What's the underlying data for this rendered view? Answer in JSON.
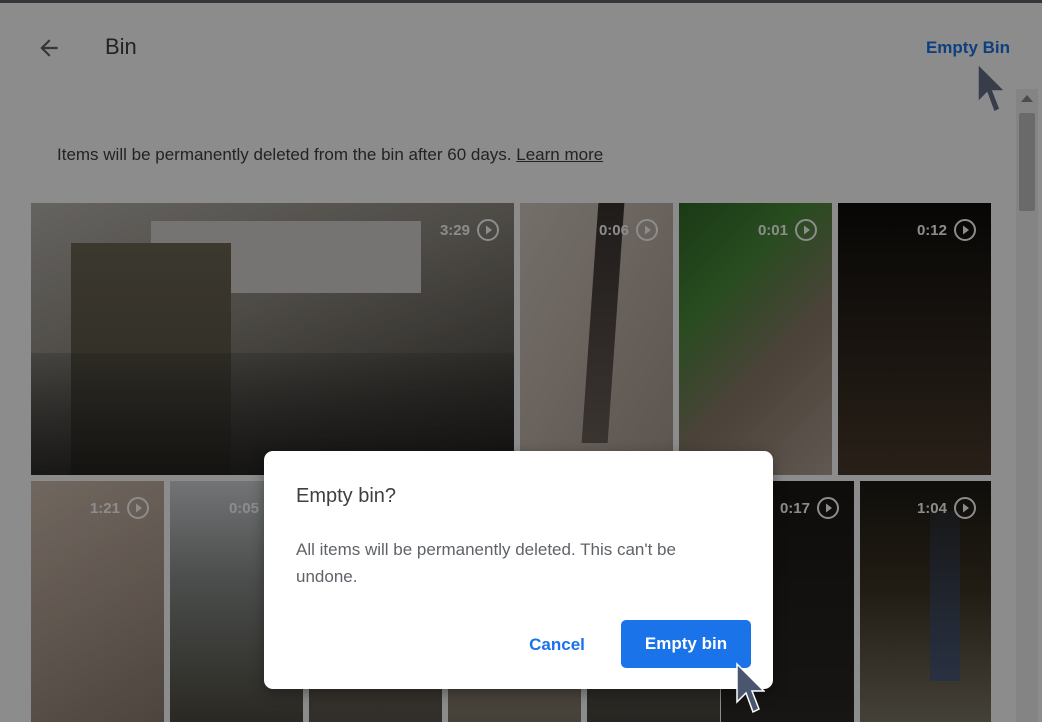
{
  "header": {
    "back_icon": "arrow-back-icon",
    "title": "Bin",
    "action_label": "Empty Bin"
  },
  "info": {
    "text": "Items will be permanently deleted from the bin after 60 days.",
    "link": "Learn more"
  },
  "grid": {
    "row1": [
      {
        "duration": "3:29",
        "icon": "play-icon"
      },
      {
        "duration": "0:06",
        "icon": "play-icon"
      },
      {
        "duration": "0:01",
        "icon": "play-icon"
      },
      {
        "duration": "0:12",
        "icon": "play-icon"
      }
    ],
    "row2": [
      {
        "duration": "1:21",
        "icon": "play-icon"
      },
      {
        "duration": "0:05",
        "icon": "play-icon"
      },
      {
        "duration": "",
        "icon": ""
      },
      {
        "duration": "",
        "icon": ""
      },
      {
        "duration": "",
        "icon": ""
      },
      {
        "duration": "0:17",
        "icon": "play-icon"
      },
      {
        "duration": "1:04",
        "icon": "play-icon"
      }
    ]
  },
  "dialog": {
    "title": "Empty bin?",
    "body": "All items will be permanently deleted. This can't be undone.",
    "cancel_label": "Cancel",
    "confirm_label": "Empty bin"
  },
  "colors": {
    "accent": "#1a73e8",
    "text": "#3c4043",
    "overlay": "rgba(0,0,0,0.45)"
  }
}
